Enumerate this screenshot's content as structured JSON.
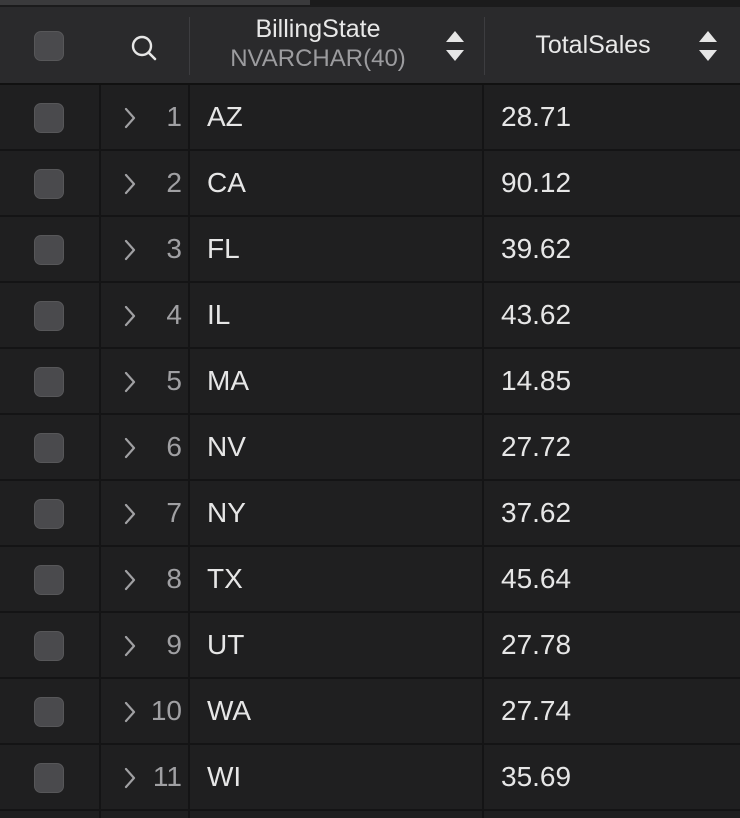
{
  "header": {
    "billing_state": {
      "title": "BillingState",
      "type": "NVARCHAR(40)"
    },
    "total_sales": {
      "title": "TotalSales"
    }
  },
  "rows": [
    {
      "index": "1",
      "state": "AZ",
      "sales": "28.71"
    },
    {
      "index": "2",
      "state": "CA",
      "sales": "90.12"
    },
    {
      "index": "3",
      "state": "FL",
      "sales": "39.62"
    },
    {
      "index": "4",
      "state": "IL",
      "sales": "43.62"
    },
    {
      "index": "5",
      "state": "MA",
      "sales": "14.85"
    },
    {
      "index": "6",
      "state": "NV",
      "sales": "27.72"
    },
    {
      "index": "7",
      "state": "NY",
      "sales": "37.62"
    },
    {
      "index": "8",
      "state": "TX",
      "sales": "45.64"
    },
    {
      "index": "9",
      "state": "UT",
      "sales": "27.78"
    },
    {
      "index": "10",
      "state": "WA",
      "sales": "27.74"
    },
    {
      "index": "11",
      "state": "WI",
      "sales": "35.69"
    }
  ],
  "colors": {
    "background": "#1f1f20",
    "header_background": "#2a2a2c",
    "checkbox": "#4a4a4d",
    "text": "#e6e6e6",
    "muted_text": "#9c9c9f"
  }
}
